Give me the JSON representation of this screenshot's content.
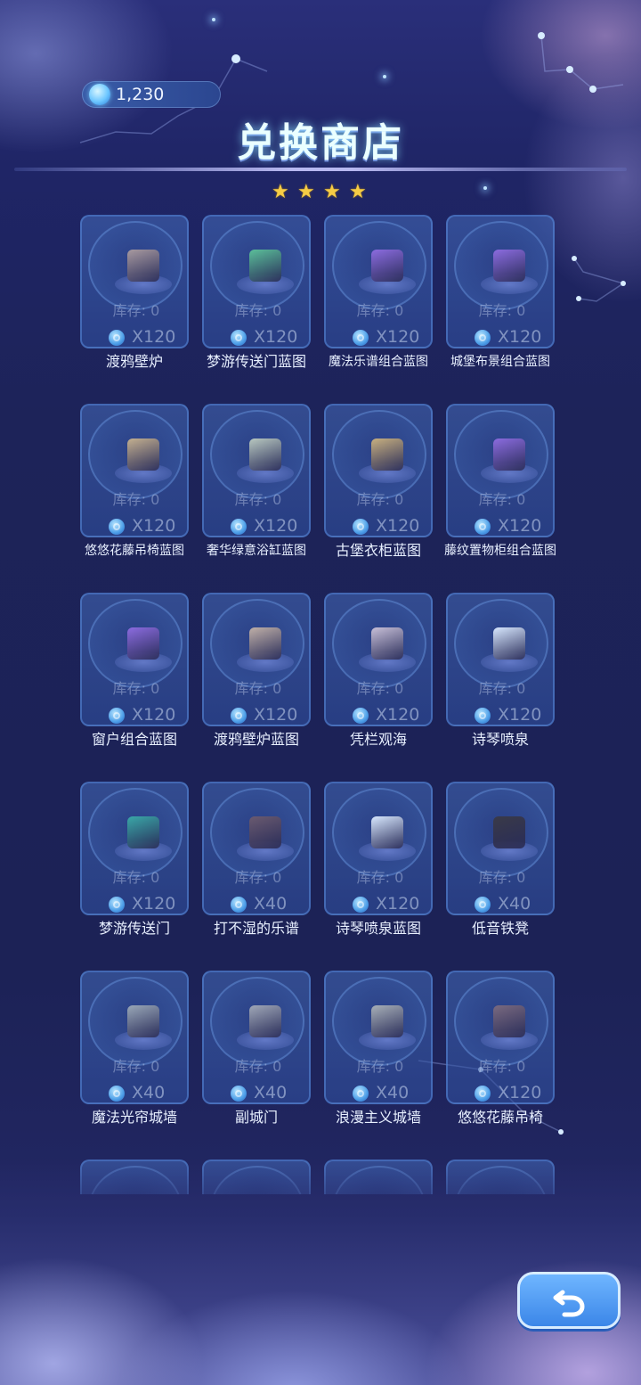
{
  "header": {
    "currency_amount": "1,230",
    "title": "兑换商店",
    "star_rating": 4
  },
  "items": [
    {
      "stock": "库存: 0",
      "price": "X120",
      "name": "渡鸦壁炉",
      "icon": "fireplace-icon",
      "color": "#a89aa0"
    },
    {
      "stock": "库存: 0",
      "price": "X120",
      "name": "梦游传送门蓝图",
      "icon": "portal-blueprint-icon",
      "color": "#5bbf9a"
    },
    {
      "stock": "库存: 0",
      "price": "X120",
      "name": "魔法乐谱组合蓝图",
      "icon": "blueprint-icon",
      "color": "#8c6ce0"
    },
    {
      "stock": "库存: 0",
      "price": "X120",
      "name": "城堡布景组合蓝图",
      "icon": "blueprint-icon",
      "color": "#8c6ce0"
    },
    {
      "stock": "库存: 0",
      "price": "X120",
      "name": "悠悠花藤吊椅蓝图",
      "icon": "blueprint-icon",
      "color": "#c4b090"
    },
    {
      "stock": "库存: 0",
      "price": "X120",
      "name": "奢华绿意浴缸蓝图",
      "icon": "bathtub-blueprint-icon",
      "color": "#b8c8c0"
    },
    {
      "stock": "库存: 0",
      "price": "X120",
      "name": "古堡衣柜蓝图",
      "icon": "wardrobe-blueprint-icon",
      "color": "#c8b080"
    },
    {
      "stock": "库存: 0",
      "price": "X120",
      "name": "藤纹置物柜组合蓝图",
      "icon": "blueprint-icon",
      "color": "#8c6ce0"
    },
    {
      "stock": "库存: 0",
      "price": "X120",
      "name": "窗户组合蓝图",
      "icon": "blueprint-icon",
      "color": "#8c6ce0"
    },
    {
      "stock": "库存: 0",
      "price": "X120",
      "name": "渡鸦壁炉蓝图",
      "icon": "fireplace-blueprint-icon",
      "color": "#c0b0a8"
    },
    {
      "stock": "库存: 0",
      "price": "X120",
      "name": "凭栏观海",
      "icon": "railing-icon",
      "color": "#c8c0d8"
    },
    {
      "stock": "库存: 0",
      "price": "X120",
      "name": "诗琴喷泉",
      "icon": "fountain-icon",
      "color": "#d8e8ff"
    },
    {
      "stock": "库存: 0",
      "price": "X120",
      "name": "梦游传送门",
      "icon": "portal-icon",
      "color": "#3aa8a8"
    },
    {
      "stock": "库存: 0",
      "price": "X40",
      "name": "打不湿的乐谱",
      "icon": "music-score-icon",
      "color": "#6a5a70"
    },
    {
      "stock": "库存: 0",
      "price": "X120",
      "name": "诗琴喷泉蓝图",
      "icon": "fountain-blueprint-icon",
      "color": "#d8e8ff"
    },
    {
      "stock": "库存: 0",
      "price": "X40",
      "name": "低音铁凳",
      "icon": "stool-icon",
      "color": "#3a3a48"
    },
    {
      "stock": "库存: 0",
      "price": "X40",
      "name": "魔法光帘城墙",
      "icon": "castle-wall-icon",
      "color": "#9aa8b8"
    },
    {
      "stock": "库存: 0",
      "price": "X40",
      "name": "副城门",
      "icon": "castle-gate-icon",
      "color": "#a0a8b8"
    },
    {
      "stock": "库存: 0",
      "price": "X40",
      "name": "浪漫主义城墙",
      "icon": "castle-wall-icon",
      "color": "#a8b0b8"
    },
    {
      "stock": "库存: 0",
      "price": "X120",
      "name": "悠悠花藤吊椅",
      "icon": "swing-chair-icon",
      "color": "#7a6a80"
    },
    {
      "stock": "",
      "price": "",
      "name": "",
      "icon": "partial-item-icon",
      "color": "#5a6a88"
    },
    {
      "stock": "",
      "price": "",
      "name": "",
      "icon": "partial-item-icon",
      "color": "#5a6a88"
    },
    {
      "stock": "",
      "price": "",
      "name": "",
      "icon": "partial-item-icon",
      "color": "#5a6a88"
    },
    {
      "stock": "",
      "price": "",
      "name": "",
      "icon": "partial-item-icon",
      "color": "#b06070"
    }
  ],
  "colors": {
    "background": "#1d2357",
    "title_glow": "#eaffff",
    "star": "#f6cc45",
    "back_button": "#4c98f0"
  },
  "back_button": {
    "icon": "undo-arrow-icon"
  }
}
